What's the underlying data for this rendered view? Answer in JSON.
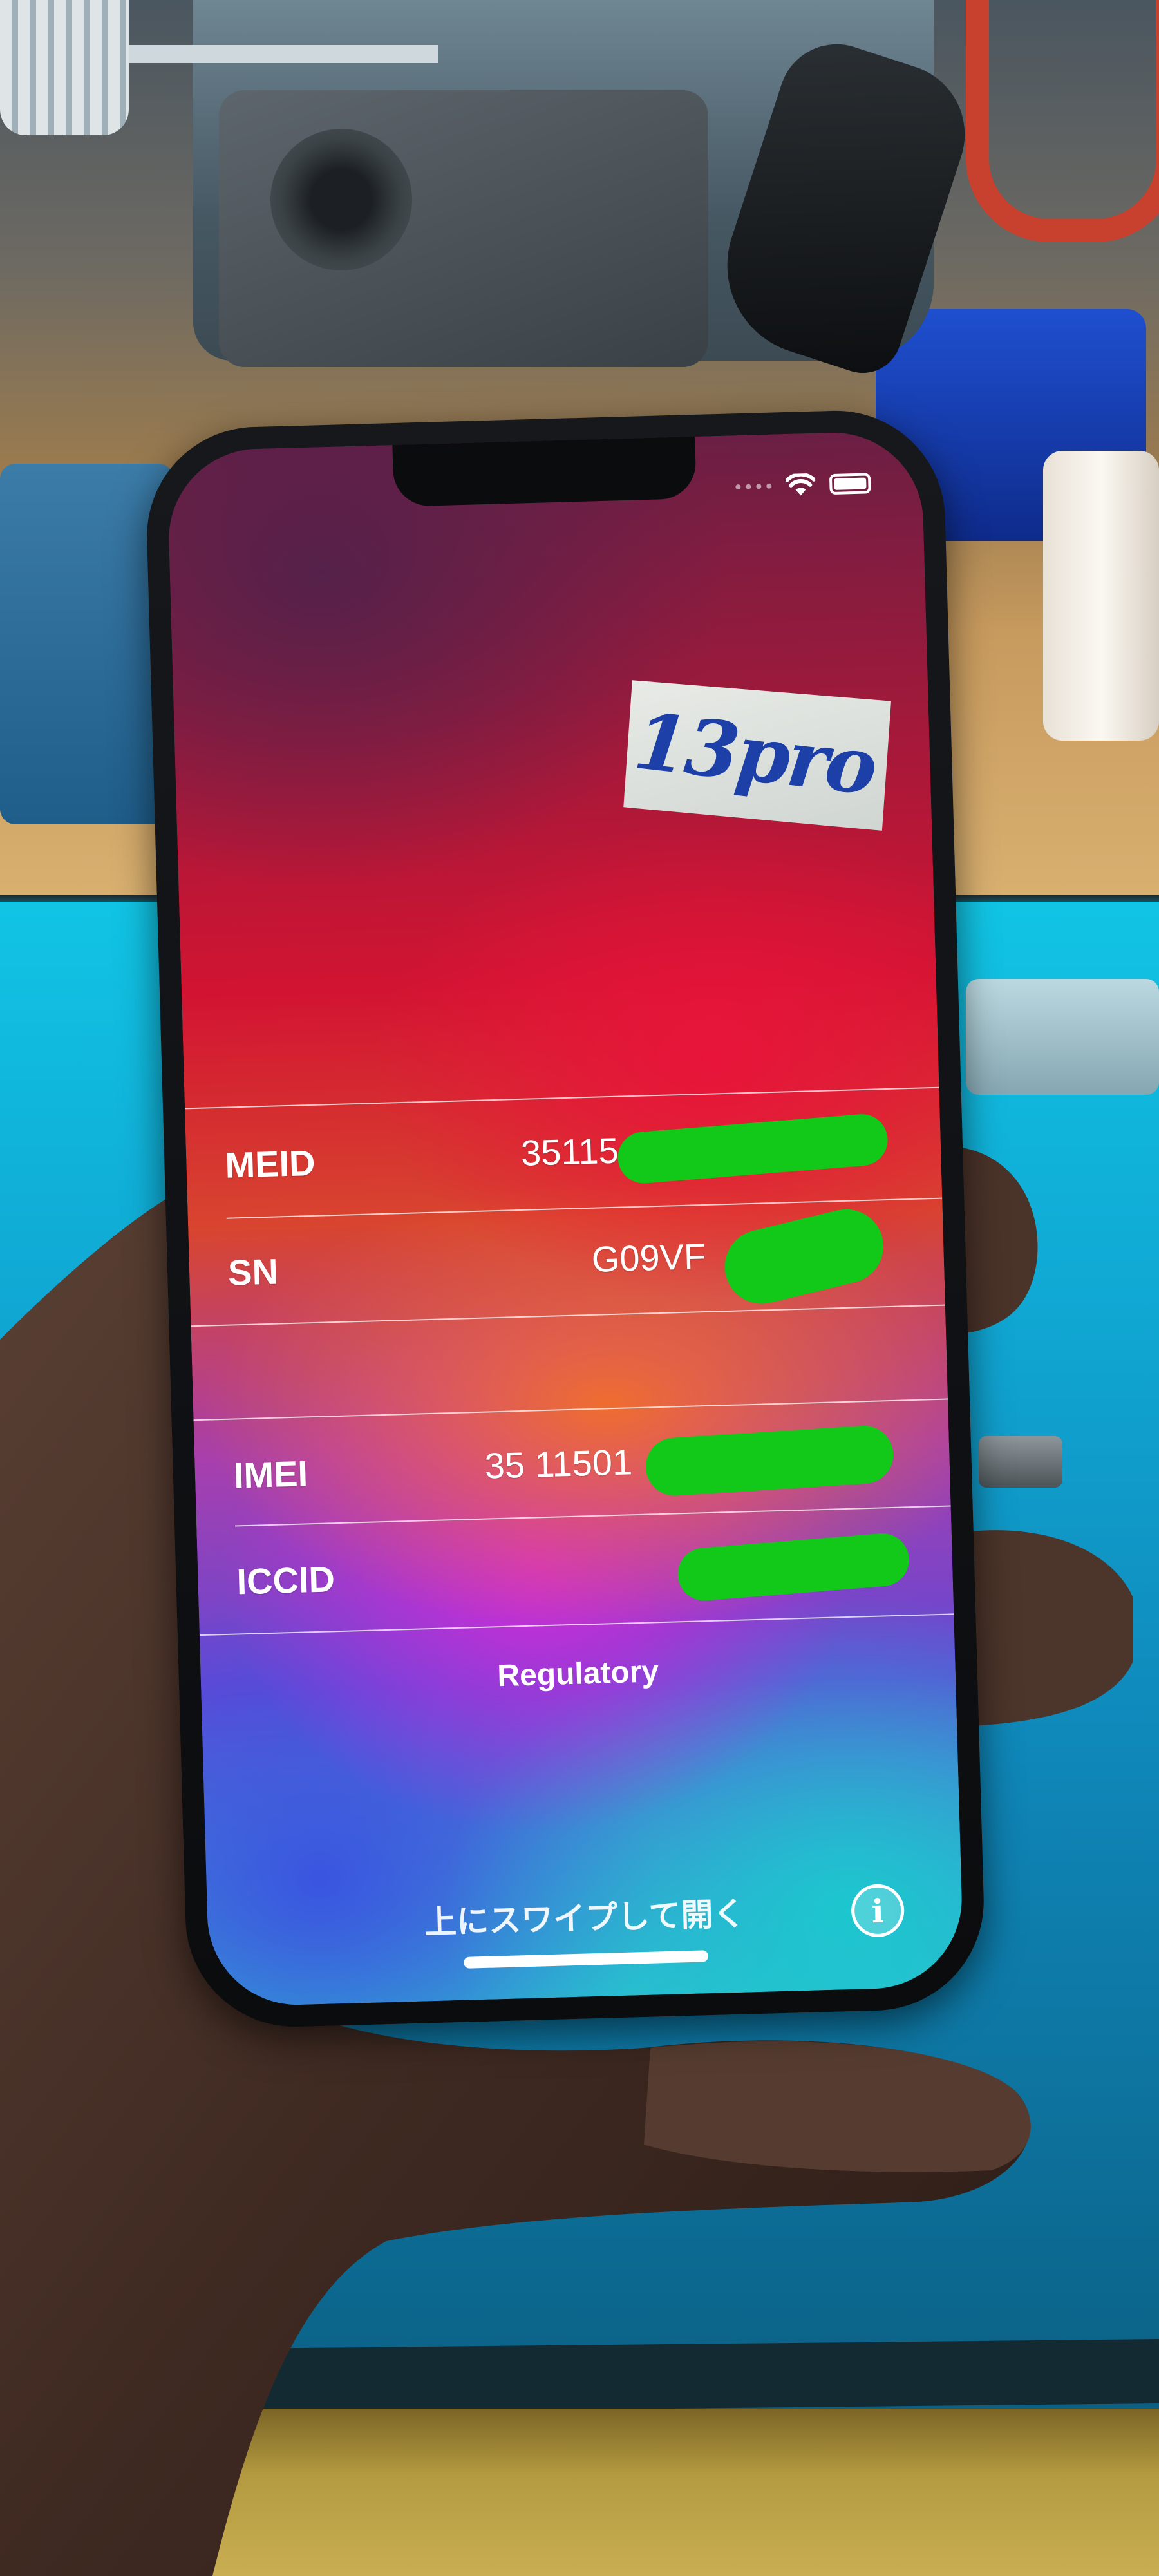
{
  "sticker": {
    "text": "13pro"
  },
  "device_info": {
    "rows": [
      {
        "label": "MEID",
        "value": "35115"
      },
      {
        "label": "SN",
        "value": "G09VF"
      },
      {
        "label": "IMEI",
        "value": "35 11501"
      },
      {
        "label": "ICCID",
        "value": ""
      }
    ]
  },
  "regulatory_label": "Regulatory",
  "swipe_prompt": "上にスワイプして開く",
  "info_icon": "i"
}
